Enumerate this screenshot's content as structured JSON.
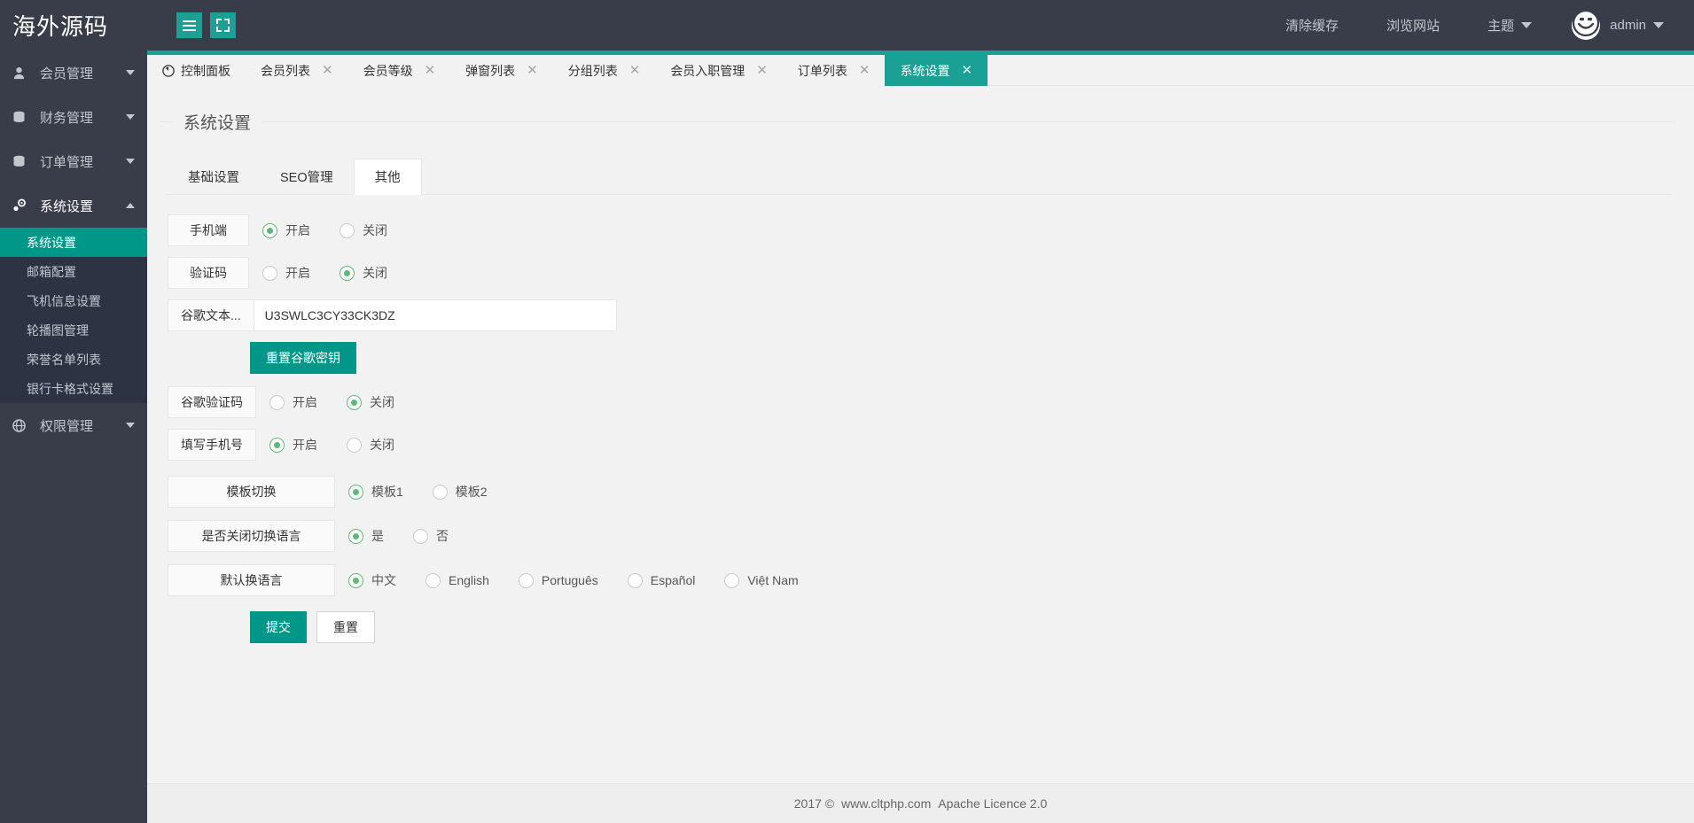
{
  "header": {
    "logo": "海外源码",
    "menu_toggle_icon": "hamburger-icon",
    "fullscreen_icon": "expand-icon",
    "right_items": [
      {
        "label": "清除缓存",
        "icon": "",
        "caret": false
      },
      {
        "label": "浏览网站",
        "icon": "",
        "caret": false
      },
      {
        "label": "主题",
        "icon": "",
        "caret": true
      }
    ],
    "user": {
      "name": "admin",
      "avatar_icon": "smiley-face-icon",
      "caret": true
    }
  },
  "sidebar": {
    "items": [
      {
        "label": "会员管理",
        "icon": "user-icon",
        "expanded": false
      },
      {
        "label": "财务管理",
        "icon": "database-icon",
        "expanded": false
      },
      {
        "label": "订单管理",
        "icon": "database-icon",
        "expanded": false
      },
      {
        "label": "系统设置",
        "icon": "gear-icon",
        "expanded": true
      },
      {
        "label": "权限管理",
        "icon": "globe-icon",
        "expanded": false
      }
    ],
    "sub_items": [
      {
        "label": "系统设置",
        "selected": true
      },
      {
        "label": "邮箱配置",
        "selected": false
      },
      {
        "label": "飞机信息设置",
        "selected": false
      },
      {
        "label": "轮播图管理",
        "selected": false
      },
      {
        "label": "荣誉名单列表",
        "selected": false
      },
      {
        "label": "银行卡格式设置",
        "selected": false
      }
    ]
  },
  "tabs": [
    {
      "label": "控制面板",
      "icon": "dashboard-icon",
      "closable": false,
      "active": false
    },
    {
      "label": "会员列表",
      "icon": "",
      "closable": true,
      "active": false
    },
    {
      "label": "会员等级",
      "icon": "",
      "closable": true,
      "active": false
    },
    {
      "label": "弹窗列表",
      "icon": "",
      "closable": true,
      "active": false
    },
    {
      "label": "分组列表",
      "icon": "",
      "closable": true,
      "active": false
    },
    {
      "label": "会员入职管理",
      "icon": "",
      "closable": true,
      "active": false
    },
    {
      "label": "订单列表",
      "icon": "",
      "closable": true,
      "active": false
    },
    {
      "label": "系统设置",
      "icon": "",
      "closable": true,
      "active": true
    }
  ],
  "page": {
    "fieldset_title": "系统设置",
    "sub_tabs": [
      {
        "label": "基础设置",
        "active": false
      },
      {
        "label": "SEO管理",
        "active": false
      },
      {
        "label": "其他",
        "active": true
      }
    ]
  },
  "form": {
    "rows": [
      {
        "name": "mobile",
        "label": "手机端",
        "type": "radio",
        "options": [
          {
            "label": "开启",
            "checked": true
          },
          {
            "label": "关闭",
            "checked": false
          }
        ]
      },
      {
        "name": "captcha",
        "label": "验证码",
        "type": "radio",
        "options": [
          {
            "label": "开启",
            "checked": false
          },
          {
            "label": "关闭",
            "checked": true
          }
        ]
      },
      {
        "name": "google-secret",
        "label": "谷歌文本...",
        "type": "text",
        "value": "U3SWLC3CY33CK3DZ",
        "placeholder": ""
      },
      {
        "name": "google-captcha",
        "label": "谷歌验证码",
        "type": "radio",
        "options": [
          {
            "label": "开启",
            "checked": false
          },
          {
            "label": "关闭",
            "checked": true
          }
        ]
      },
      {
        "name": "fill-phone",
        "label": "填写手机号",
        "type": "radio",
        "options": [
          {
            "label": "开启",
            "checked": true
          },
          {
            "label": "关闭",
            "checked": false
          }
        ]
      },
      {
        "name": "template-switch",
        "label": "模板切换",
        "type": "radio",
        "wide": true,
        "options": [
          {
            "label": "模板1",
            "checked": true
          },
          {
            "label": "模板2",
            "checked": false
          }
        ]
      },
      {
        "name": "disable-language-switch",
        "label": "是否关闭切换语言",
        "type": "radio",
        "wide": true,
        "options": [
          {
            "label": "是",
            "checked": true
          },
          {
            "label": "否",
            "checked": false
          }
        ]
      },
      {
        "name": "default-language",
        "label": "默认换语言",
        "type": "radio",
        "wide": true,
        "options": [
          {
            "label": "中文",
            "checked": true
          },
          {
            "label": "English",
            "checked": false
          },
          {
            "label": "Português",
            "checked": false
          },
          {
            "label": "Español",
            "checked": false
          },
          {
            "label": "Việt Nam",
            "checked": false
          }
        ]
      }
    ],
    "reset_google_button": "重置谷歌密钥",
    "submit_button": "提交",
    "reset_button": "重置"
  },
  "footer": {
    "year": "2017 ©",
    "site": "www.cltphp.com",
    "license": "Apache Licence 2.0"
  }
}
